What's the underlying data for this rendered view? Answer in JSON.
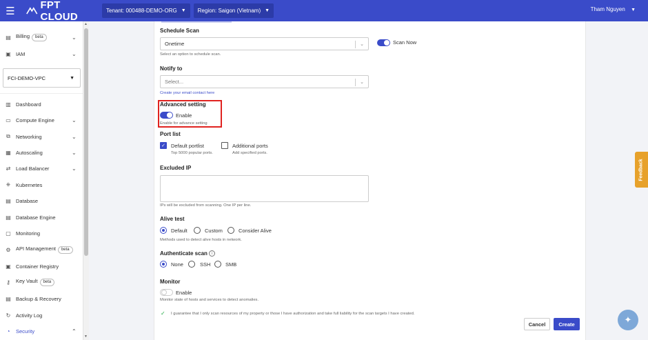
{
  "header": {
    "logo_text": "FPT CLOUD",
    "tenant_label": "Tenant: 000488-DEMO-ORG",
    "region_label": "Region: Saigon (Vietnam)",
    "user_name": "Tham Nguyen",
    "brand_color": "#3a4bc9"
  },
  "sidebar": {
    "billing": {
      "label": "Billing",
      "badge": "beta"
    },
    "iam": {
      "label": "IAM"
    },
    "vpc_selector": "FCI-DEMO-VPC",
    "items": [
      {
        "label": "Dashboard",
        "icon": "dashboard-icon"
      },
      {
        "label": "Compute Engine",
        "icon": "monitor-icon"
      },
      {
        "label": "Networking",
        "icon": "network-icon"
      },
      {
        "label": "Autoscaling",
        "icon": "autoscaling-icon"
      },
      {
        "label": "Load Balancer",
        "icon": "load-balancer-icon"
      },
      {
        "label": "Kubernetes",
        "icon": "kubernetes-icon"
      },
      {
        "label": "Database",
        "icon": "database-icon"
      },
      {
        "label": "Database Engine",
        "icon": "database-engine-icon"
      },
      {
        "label": "Monitoring",
        "icon": "monitoring-icon"
      },
      {
        "label": "API Management",
        "icon": "api-icon",
        "badge": "beta"
      },
      {
        "label": "Container Registry",
        "icon": "container-icon"
      },
      {
        "label": "Key Vault",
        "icon": "key-icon",
        "badge": "beta"
      },
      {
        "label": "Backup & Recovery",
        "icon": "backup-icon"
      },
      {
        "label": "Activity Log",
        "icon": "activity-icon"
      },
      {
        "label": "Security",
        "icon": "security-icon"
      }
    ]
  },
  "form": {
    "schedule_scan": {
      "label": "Schedule Scan",
      "value": "Onetime",
      "help": "Select an option to schedule scan.",
      "scan_now_label": "Scan Now",
      "scan_now_on": true
    },
    "notify_to": {
      "label": "Notify to",
      "placeholder": "Select...",
      "link": "Create your email contact here"
    },
    "advanced_setting": {
      "label": "Advanced setting",
      "toggle_label": "Enable",
      "help": "Enable for advance setting",
      "on": true
    },
    "port_list": {
      "label": "Port list",
      "default": {
        "label": "Default portlist",
        "help": "Top 5000 popular ports.",
        "checked": true
      },
      "additional": {
        "label": "Additional ports",
        "help": "Add specified ports.",
        "checked": false
      }
    },
    "excluded_ip": {
      "label": "Excluded IP",
      "value": "",
      "help": "IPs will be excluded from scanning. One IP per line."
    },
    "alive_test": {
      "label": "Alive test",
      "options": [
        "Default",
        "Custom",
        "Consider Alive"
      ],
      "selected": "Default",
      "help": "Methods used to detect alive hosts in network."
    },
    "authenticate_scan": {
      "label": "Authenticate scan",
      "options": [
        "None",
        "SSH",
        "SMB"
      ],
      "selected": "None"
    },
    "monitor": {
      "label": "Monitor",
      "toggle_label": "Enable",
      "help": "Monitor state of hosts and services to detect anomalies.",
      "on": false
    },
    "guarantee": "I guarantee that I only scan resources of my property or those I have authorization and take full liability for the scan targets I have created.",
    "cancel_label": "Cancel",
    "create_label": "Create"
  },
  "feedback_label": "Feedback"
}
